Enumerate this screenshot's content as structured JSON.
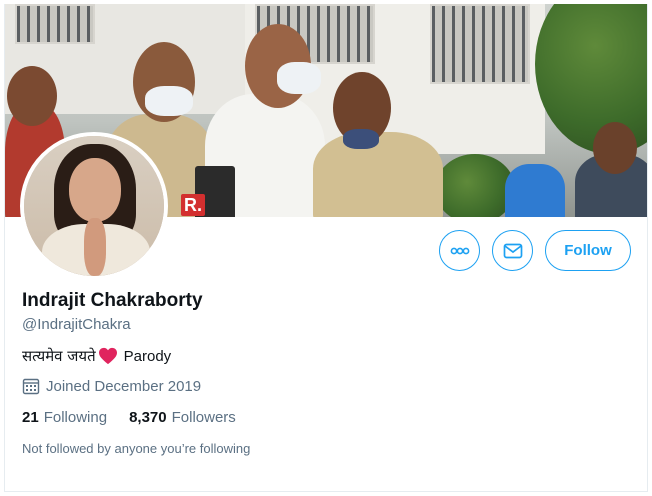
{
  "profile": {
    "name": "Indrajit Chakraborty",
    "handle": "@IndrajitChakra",
    "bio_text": "सत्यमेव जयते",
    "bio_suffix": "Parody",
    "joined": "Joined December 2019",
    "following_count": "21",
    "following_label": "Following",
    "followers_count": "8,370",
    "followers_label": "Followers",
    "not_followed_text": "Not followed by anyone you’re following"
  },
  "actions": {
    "more_icon": "more-icon",
    "message_icon": "envelope-icon",
    "follow_label": "Follow"
  },
  "banner": {
    "mic_label": "R."
  },
  "colors": {
    "accent": "#1da1f2",
    "secondary_text": "#5b7083",
    "heart": "#e0245e"
  }
}
